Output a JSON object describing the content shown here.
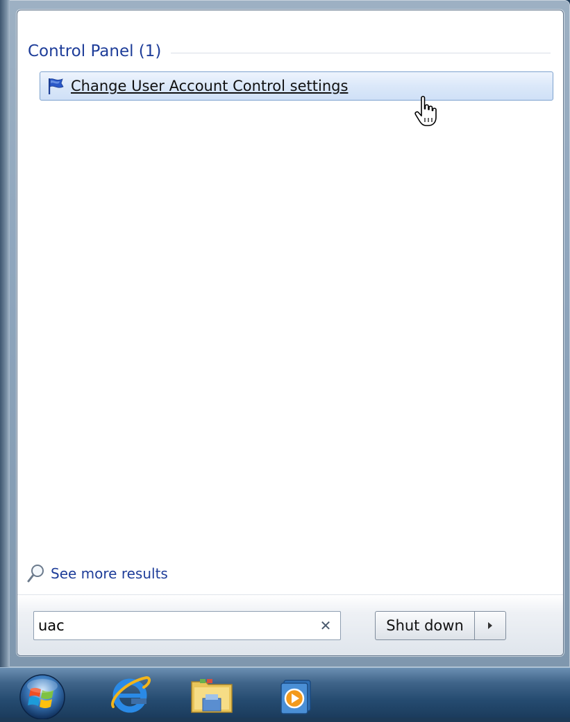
{
  "start_menu": {
    "group": {
      "title": "Control Panel (1)"
    },
    "results": [
      {
        "label": "Change User Account Control settings",
        "icon": "uac-flag-icon"
      }
    ],
    "see_more_label": "See more results",
    "search": {
      "value": "uac",
      "clear_icon": "close-icon"
    },
    "shutdown": {
      "label": "Shut down",
      "arrow_icon": "triangle-right-icon"
    }
  },
  "taskbar": {
    "items": [
      {
        "icon": "windows-start-orb-icon"
      },
      {
        "icon": "internet-explorer-icon"
      },
      {
        "icon": "windows-explorer-icon"
      },
      {
        "icon": "windows-media-player-icon"
      }
    ]
  },
  "colors": {
    "group_title": "#1e3d99",
    "highlight_border": "#7da2ce",
    "highlight_fill": "#dbe8f9",
    "taskbar": "#254b70"
  }
}
